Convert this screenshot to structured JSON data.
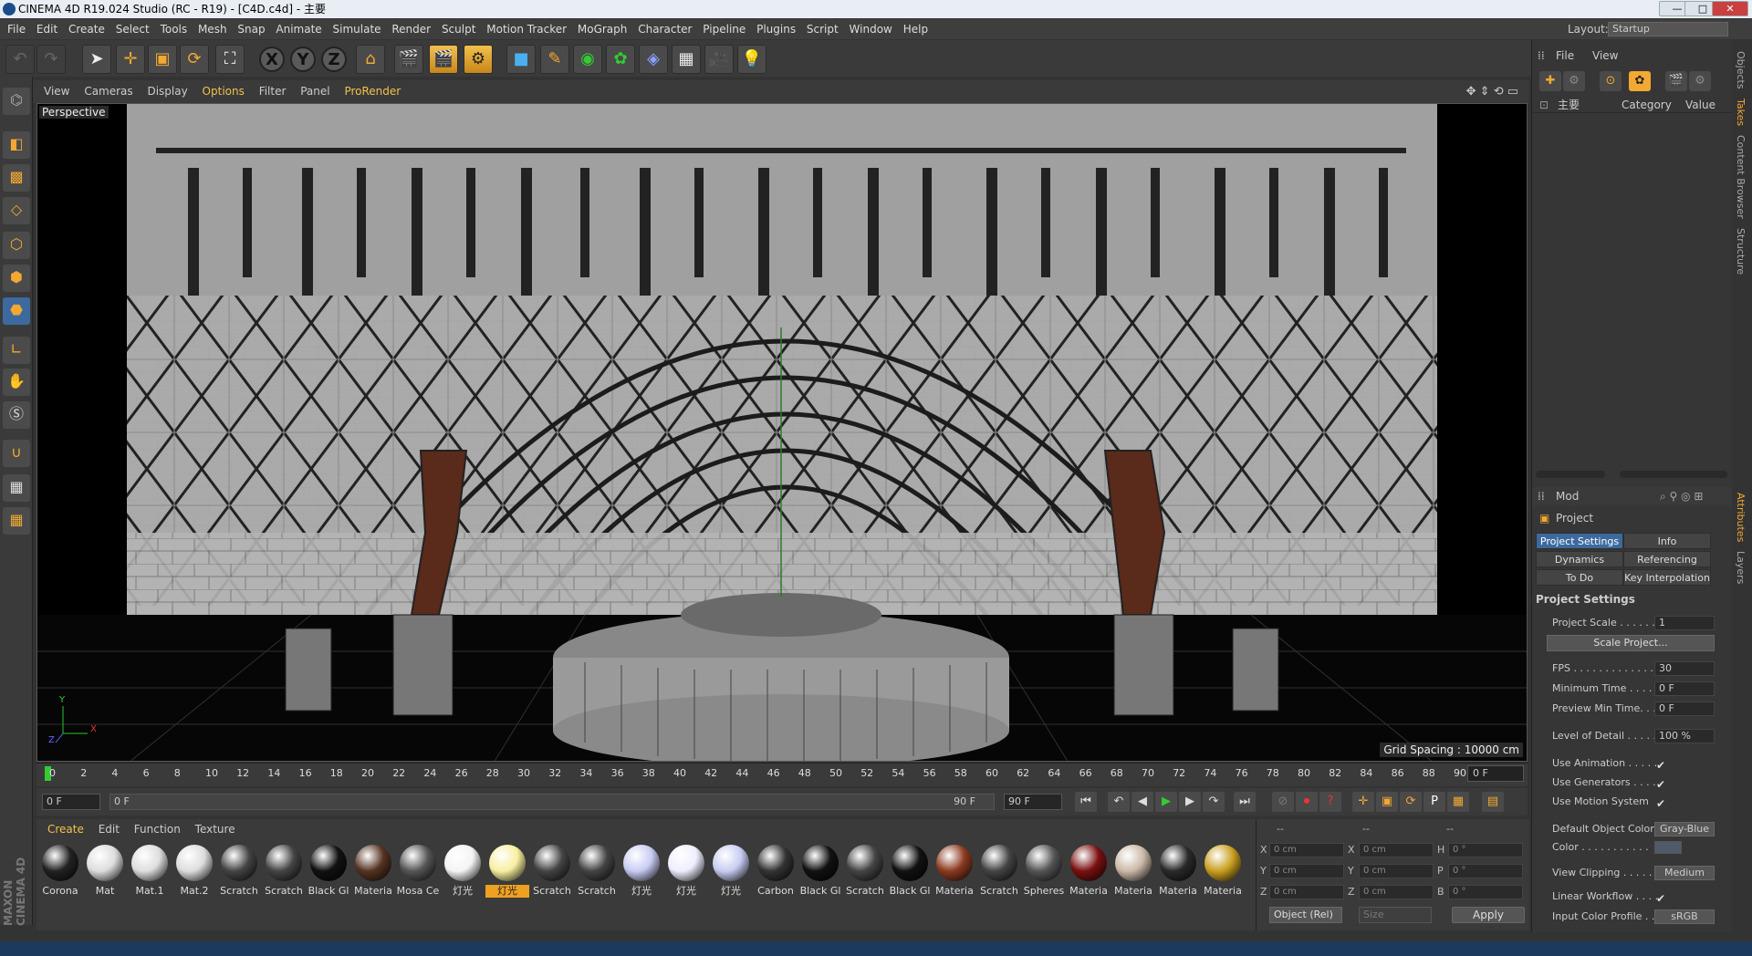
{
  "window": {
    "title": "CINEMA 4D R19.024 Studio (RC - R19) - [C4D.c4d] - 主要",
    "min": "—",
    "max": "□",
    "close": "✕"
  },
  "menu": [
    "File",
    "Edit",
    "Create",
    "Select",
    "Tools",
    "Mesh",
    "Snap",
    "Animate",
    "Simulate",
    "Render",
    "Sculpt",
    "Motion Tracker",
    "MoGraph",
    "Character",
    "Pipeline",
    "Plugins",
    "Script",
    "Window",
    "Help"
  ],
  "layout": {
    "label": "Layout:",
    "value": "Startup"
  },
  "viewport_menu": [
    "View",
    "Cameras",
    "Display",
    "Options",
    "Filter",
    "Panel",
    "ProRender"
  ],
  "viewport": {
    "label": "Perspective",
    "grid_spacing": "Grid Spacing : 10000 cm",
    "axis_y": "Y",
    "axis_x": "X",
    "axis_z": "Z"
  },
  "timeline": {
    "ticks": [
      "0",
      "2",
      "4",
      "6",
      "8",
      "10",
      "12",
      "14",
      "16",
      "18",
      "20",
      "22",
      "24",
      "26",
      "28",
      "30",
      "32",
      "34",
      "36",
      "38",
      "40",
      "42",
      "44",
      "46",
      "48",
      "50",
      "52",
      "54",
      "56",
      "58",
      "60",
      "62",
      "64",
      "66",
      "68",
      "70",
      "72",
      "74",
      "76",
      "78",
      "80",
      "82",
      "84",
      "86",
      "88",
      "90"
    ],
    "frame": "0 F"
  },
  "transport": {
    "start": "0 F",
    "range_start": "0 F",
    "range_end": "90 F",
    "end": "90 F"
  },
  "material_menu": [
    "Create",
    "Edit",
    "Function",
    "Texture"
  ],
  "materials": [
    {
      "label": "Corona",
      "color": "#222"
    },
    {
      "label": "Mat",
      "color": "#ddd"
    },
    {
      "label": "Mat.1",
      "color": "#ddd"
    },
    {
      "label": "Mat.2",
      "color": "#ddd"
    },
    {
      "label": "Scratch",
      "color": "#444"
    },
    {
      "label": "Scratch",
      "color": "#444"
    },
    {
      "label": "Black Gl",
      "color": "#111"
    },
    {
      "label": "Materia",
      "color": "#553322"
    },
    {
      "label": "Mosa Ce",
      "color": "#555"
    },
    {
      "label": "灯光",
      "color": "#f4f4f4"
    },
    {
      "label": "灯光",
      "color": "#f7efa0"
    },
    {
      "label": "Scratch",
      "color": "#444"
    },
    {
      "label": "Scratch",
      "color": "#444"
    },
    {
      "label": "灯光",
      "color": "#c8ccf2"
    },
    {
      "label": "灯光",
      "color": "#eef"
    },
    {
      "label": "灯光",
      "color": "#c8ccf2"
    },
    {
      "label": "Carbon",
      "color": "#333"
    },
    {
      "label": "Black Gl",
      "color": "#111"
    },
    {
      "label": "Scratch",
      "color": "#444"
    },
    {
      "label": "Black Gl",
      "color": "#111"
    },
    {
      "label": "Materia",
      "color": "#8a3a20"
    },
    {
      "label": "Scratch",
      "color": "#444"
    },
    {
      "label": "Spheres",
      "color": "#555"
    },
    {
      "label": "Materia",
      "color": "#7a1010"
    },
    {
      "label": "Materia",
      "color": "#cbb9a8"
    },
    {
      "label": "Materia",
      "color": "#2a2a2a"
    },
    {
      "label": "Materia",
      "color": "#c9a020"
    }
  ],
  "coords": {
    "pos_x": "0 cm",
    "pos_y": "0 cm",
    "pos_z": "0 cm",
    "size_x": "0 cm",
    "size_y": "0 cm",
    "size_z": "0 cm",
    "rot_h": "0 °",
    "rot_p": "0 °",
    "rot_b": "0 °",
    "object_mode": "Object (Rel)",
    "size_mode": "Size",
    "apply": "Apply",
    "hdr1": "--",
    "hdr2": "--",
    "hdr3": "--",
    "lx": "X",
    "ly": "Y",
    "lz": "Z",
    "lx2": "X",
    "ly2": "Y",
    "lz2": "Z",
    "lh": "H",
    "lp": "P",
    "lb": "B"
  },
  "objects": {
    "menu_file": "File",
    "menu_view": "View",
    "root": "主要",
    "col_category": "Category",
    "col_value": "Value"
  },
  "attributes": {
    "mode": "Mod",
    "title": "Project",
    "tabs": [
      "Project Settings",
      "Info",
      "Dynamics",
      "Referencing",
      "To Do",
      "Key Interpolation"
    ],
    "section": "Project Settings",
    "project_scale_label": "Project Scale . . . . . .",
    "project_scale": "1",
    "scale_button": "Scale Project...",
    "fps_label": "FPS . . . . . . . . . . . . . .",
    "fps": "30",
    "min_time_label": "Minimum Time . . . . .",
    "min_time": "0 F",
    "preview_min_label": "Preview Min Time. . .",
    "preview_min": "0 F",
    "lod_label": "Level of Detail . . . . .",
    "lod": "100 %",
    "use_anim_label": "Use Animation . . . . .",
    "use_gen_label": "Use Generators . . . .",
    "use_motion_label": "Use Motion System",
    "check": "✔",
    "default_color_label": "Default Object Color",
    "default_color": "Gray-Blue",
    "color_label": "Color . . . . . . . . . . .",
    "view_clip_label": "View Clipping . . . . . .",
    "view_clip": "Medium",
    "linear_label": "Linear Workflow . . . .",
    "input_profile_label": "Input Color Profile . .",
    "input_profile": "sRGB"
  },
  "side_tabs": [
    "Objects",
    "Takes",
    "Content Browser",
    "Structure",
    "Attributes",
    "Layers"
  ],
  "brand": "MAXON CINEMA 4D"
}
